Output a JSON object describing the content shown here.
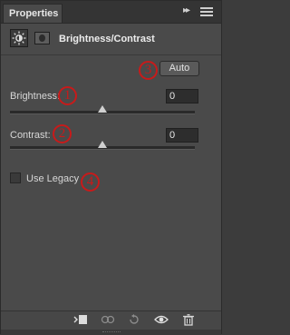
{
  "panel": {
    "tab_label": "Properties",
    "header_title": "Brightness/Contrast"
  },
  "controls": {
    "auto_label": "Auto",
    "brightness": {
      "label": "Brightness:",
      "value": "0",
      "slider_fraction": 0.5
    },
    "contrast": {
      "label": "Contrast:",
      "value": "0",
      "slider_fraction": 0.5
    },
    "use_legacy": {
      "label": "Use Legacy",
      "checked": false
    }
  },
  "annotations": [
    "1",
    "2",
    "3",
    "4"
  ],
  "colors": {
    "annotation": "#c81a1a",
    "panel_bg": "#4a4a4a"
  },
  "toolbar": {
    "icons": [
      "clip-to-layer-icon",
      "previous-state-icon",
      "reset-icon",
      "visibility-icon",
      "trash-icon"
    ]
  }
}
